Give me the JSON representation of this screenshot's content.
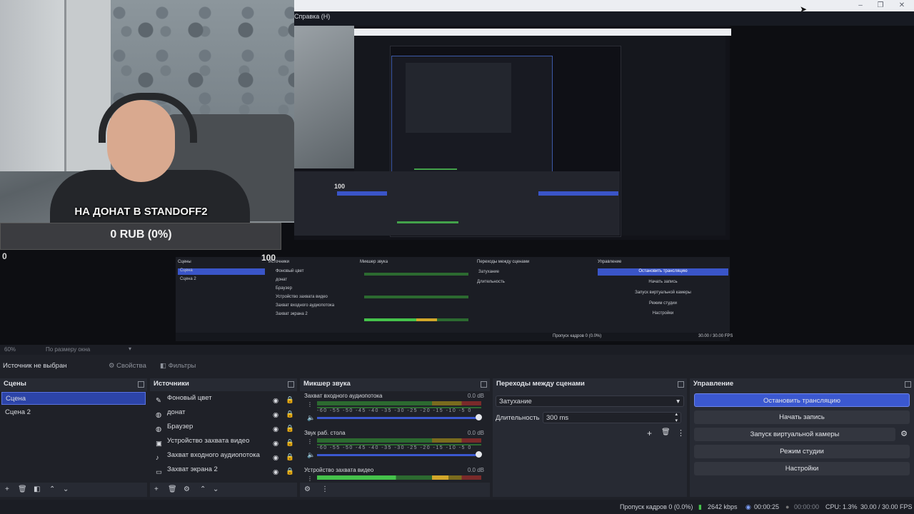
{
  "window": {
    "menu_help": "Справка (Н)"
  },
  "overlay": {
    "donate_title": "НА ДОНАТ В STANDOFF2",
    "donate_amount": "0 RUB (0%)",
    "donate_count": "0",
    "nested_counter": "100"
  },
  "preview_status": {
    "zoom": "60%",
    "fit": "По размеру окна"
  },
  "context_bar": {
    "no_source": "Источник не выбран",
    "properties": "Свойства",
    "filters": "Фильтры"
  },
  "scenes": {
    "title": "Сцены",
    "items": [
      "Сцена",
      "Сцена 2"
    ],
    "selected": "Сцена"
  },
  "sources": {
    "title": "Источники",
    "items": [
      {
        "label": "Фоновый цвет",
        "icon": "brush-icon"
      },
      {
        "label": "донат",
        "icon": "globe-icon"
      },
      {
        "label": "Браузер",
        "icon": "globe-icon"
      },
      {
        "label": "Устройство захвата видео",
        "icon": "camera-icon"
      },
      {
        "label": "Захват входного аудиопотока",
        "icon": "microphone-icon"
      },
      {
        "label": "Захват экрана 2",
        "icon": "monitor-icon"
      }
    ]
  },
  "mixer": {
    "title": "Микшер звука",
    "channels": [
      {
        "name": "Захват входного аудиопотока",
        "db": "0.0 dB"
      },
      {
        "name": "Звук раб. стола",
        "db": "0.0 dB"
      },
      {
        "name": "Устройство захвата видео",
        "db": "0.0 dB"
      }
    ],
    "scale": "-60 -55 -50 -45 -40 -35 -30 -25 -20 -15 -10 -5 0"
  },
  "transitions": {
    "title": "Переходы между сценами",
    "selected": "Затухание",
    "duration_label": "Длительность",
    "duration_value": "300 ms"
  },
  "controls": {
    "title": "Управление",
    "stop_stream": "Остановить трансляцию",
    "start_record": "Начать запись",
    "virtual_camera": "Запуск виртуальной камеры",
    "studio_mode": "Режим студии",
    "settings": "Настройки"
  },
  "status": {
    "dropped": "Пропуск кадров 0 (0.0%)",
    "bitrate": "2642 kbps",
    "stream_time": "00:00:25",
    "record_time": "00:00:00",
    "cpu": "CPU: 1.3%",
    "fps": "30.00 / 30.00 FPS"
  },
  "colors": {
    "accent": "#3b58d0",
    "selected": "#2c44a8",
    "dock_bg": "#272a33"
  }
}
